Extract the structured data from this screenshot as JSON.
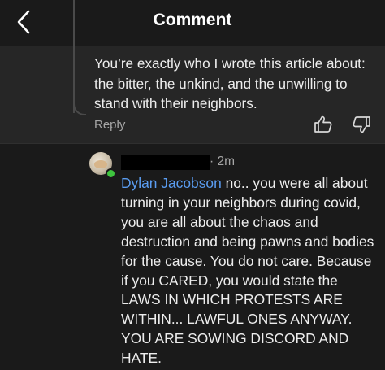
{
  "header": {
    "title": "Comment",
    "back_icon": "chevron-left-icon"
  },
  "parent_comment": {
    "text": "You’re exactly who I wrote this article about: the bitter, the unkind, and the unwilling to stand with their neighbors.",
    "reply_label": "Reply",
    "like_icon": "thumbs-up-icon",
    "dislike_icon": "thumbs-down-icon"
  },
  "reply_comment": {
    "author_redacted": true,
    "timestamp": "· 2m",
    "mention": "Dylan Jacobson",
    "body": " no.. you were all about turning in your neighbors during covid, you are all about the chaos and destruction and being pawns and bodies for the cause. You do not care. Because if you CARED, you would state the LAWS IN WHICH PROTESTS ARE WITHIN... LAWFUL ONES ANYWAY. YOU ARE SOWING DISCORD AND HATE.",
    "online": true
  },
  "colors": {
    "background": "#1a1a1a",
    "parent_background": "#262626",
    "mention": "#5a9cf0",
    "secondary_text": "#a6a6a6",
    "online_dot": "#3ec43e"
  }
}
